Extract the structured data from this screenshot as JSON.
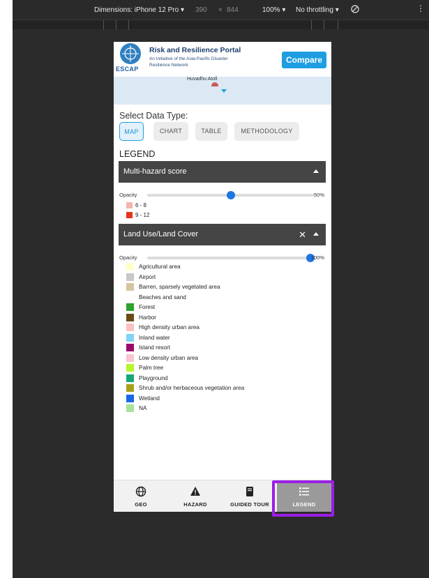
{
  "devtools": {
    "device": "Dimensions: iPhone 12 Pro ▾",
    "width": "390",
    "times": "×",
    "height": "844",
    "zoom": "100% ▾",
    "throttle": "No throttling ▾"
  },
  "header": {
    "logo_text": "ESCAP",
    "title": "Risk and Resilience Portal",
    "subtitle_line1": "An Initiative of the Asia-Pacific Disaster",
    "subtitle_line2": "Resilience Network",
    "compare_label": "Compare"
  },
  "map": {
    "place_label": "Huvadhu Atoll"
  },
  "data_type": {
    "label": "Select Data Type:",
    "tabs": [
      {
        "label": "MAP",
        "active": true
      },
      {
        "label": "CHART",
        "active": false
      },
      {
        "label": "TABLE",
        "active": false
      },
      {
        "label": "METHODOLOGY",
        "active": false
      }
    ]
  },
  "legend": {
    "title": "LEGEND",
    "multi_hazard": {
      "header": "Multi-hazard score",
      "opacity_label": "Opacity",
      "opacity_value": "50%",
      "opacity_level": 0.5,
      "items": [
        {
          "label": "6 - 8",
          "color": "#f4b6ad"
        },
        {
          "label": "9 - 12",
          "color": "#e8331c"
        }
      ]
    },
    "land_use": {
      "header": "Land Use/Land Cover",
      "close_label": "✕",
      "opacity_label": "Opacity",
      "opacity_value": "100%",
      "opacity_level": 1.0,
      "items": [
        {
          "label": "Agricultural area",
          "color": "#ffffc8"
        },
        {
          "label": "Airport",
          "color": "#c8c8c8"
        },
        {
          "label": "Barren, sparsely vegetated area",
          "color": "#d8c4a0"
        },
        {
          "label": "Beaches and sand",
          "color": "#ffffff"
        },
        {
          "label": "Forest",
          "color": "#2ea12e"
        },
        {
          "label": "Harbor",
          "color": "#6b4a12"
        },
        {
          "label": "High density urban area",
          "color": "#f9c2c2"
        },
        {
          "label": "Inland water",
          "color": "#7fd3f7"
        },
        {
          "label": "Island resort",
          "color": "#9b0a6b"
        },
        {
          "label": "Low density urban area",
          "color": "#f9c5cf"
        },
        {
          "label": "Palm tree",
          "color": "#b7f52f"
        },
        {
          "label": "Playground",
          "color": "#19a77a"
        },
        {
          "label": "Shrub and/or herbaceous vegetation area",
          "color": "#a9a01b"
        },
        {
          "label": "Wetland",
          "color": "#1c67e6"
        },
        {
          "label": "NA",
          "color": "#a7e29a"
        }
      ]
    }
  },
  "bottom_nav": [
    {
      "label": "GEO",
      "icon": "globe-icon"
    },
    {
      "label": "HAZARD",
      "icon": "warning-icon"
    },
    {
      "label": "GUIDED TOUR",
      "icon": "book-icon"
    },
    {
      "label": "LEGEND",
      "icon": "list-icon",
      "active": true
    }
  ],
  "colors": {
    "accent": "#1e9ee1",
    "panel_header": "#454545",
    "highlight": "#9b1ee6"
  }
}
